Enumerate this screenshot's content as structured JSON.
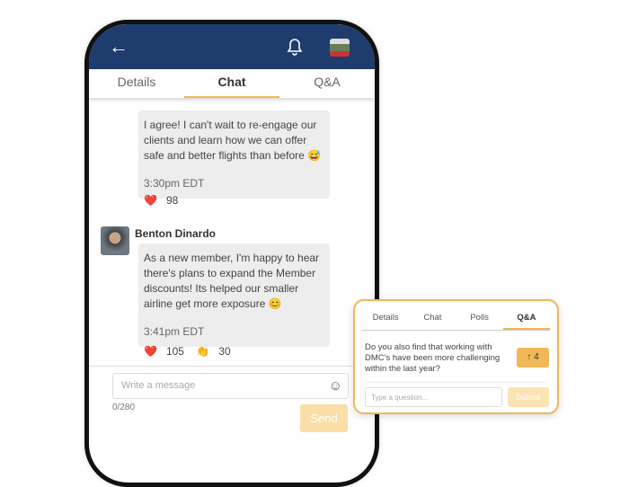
{
  "header": {
    "back_icon": "arrow-left-icon",
    "bell_icon": "bell-icon",
    "avatar": "user-avatar"
  },
  "tabs": [
    "Details",
    "Chat",
    "Q&A"
  ],
  "messages": [
    {
      "text": "I agree! I can't wait to re-engage our clients and learn how we can offer safe and better flights than before 😅",
      "time": "3:30pm EDT",
      "reactions": [
        {
          "emoji": "❤️",
          "count": "98"
        }
      ]
    },
    {
      "author": "Benton Dinardo",
      "text": "As a new member, I'm happy to hear there's plans to expand the Member discounts! Its helped our smaller airline get more exposure 😊",
      "time": "3:41pm EDT",
      "reactions": [
        {
          "emoji": "❤️",
          "count": "105"
        },
        {
          "emoji": "👏",
          "count": "30"
        }
      ]
    }
  ],
  "composer": {
    "placeholder": "Write a message",
    "counter": "0/280",
    "send": "Send",
    "emoji_icon": "☺"
  },
  "qa_panel": {
    "tabs": [
      "Details",
      "Chat",
      "Polls",
      "Q&A"
    ],
    "question": "Do you also find that working with DMC's have been more challenging within the last year?",
    "votes": "4",
    "vote_icon": "↑",
    "placeholder": "Type a question...",
    "submit": "Submit"
  },
  "colors": {
    "header": "#1e3c6e",
    "accent": "#f0b858"
  }
}
